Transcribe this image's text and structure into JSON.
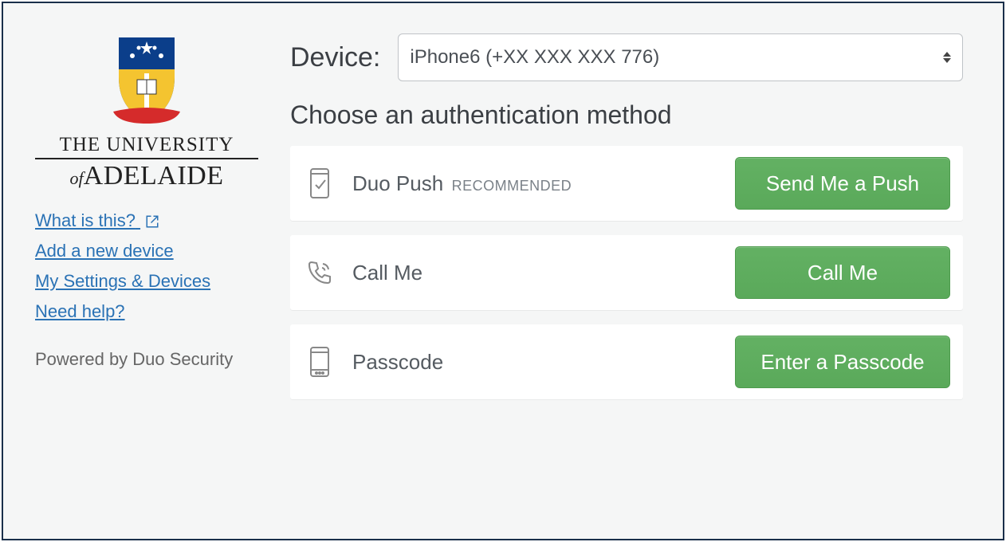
{
  "org": {
    "line1": "THE UNIVERSITY",
    "line2_of": "of",
    "line2_main": "ADELAIDE"
  },
  "sidebar": {
    "links": {
      "what_is_this": "What is this?",
      "add_device": "Add a new device",
      "my_settings": "My Settings & Devices",
      "need_help": "Need help?"
    },
    "powered": "Powered by Duo Security"
  },
  "device": {
    "label": "Device:",
    "selected": "iPhone6 (+XX XXX XXX 776)"
  },
  "heading": "Choose an authentication method",
  "methods": {
    "push": {
      "title": "Duo Push",
      "extra": "RECOMMENDED",
      "button": "Send Me a Push"
    },
    "call": {
      "title": "Call Me",
      "button": "Call Me"
    },
    "passcode": {
      "title": "Passcode",
      "button": "Enter a Passcode"
    }
  }
}
